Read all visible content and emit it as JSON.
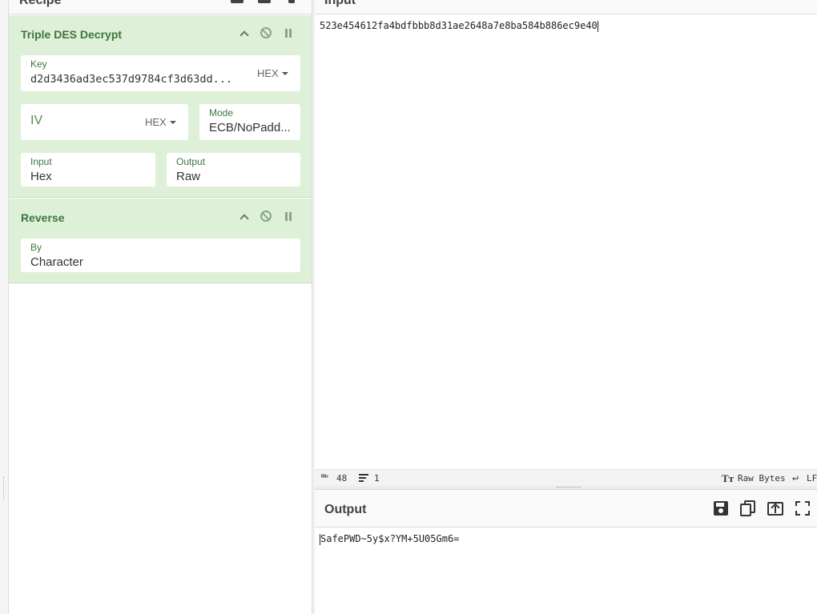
{
  "recipe": {
    "title": "Recipe",
    "operations": [
      {
        "name": "Triple DES Decrypt",
        "key": {
          "label": "Key",
          "value": "d2d3436ad3ec537d9784cf3d63dd...",
          "encoding": "HEX"
        },
        "iv": {
          "label": "IV",
          "encoding": "HEX"
        },
        "mode": {
          "label": "Mode",
          "value": "ECB/NoPadd..."
        },
        "input": {
          "label": "Input",
          "value": "Hex"
        },
        "output": {
          "label": "Output",
          "value": "Raw"
        }
      },
      {
        "name": "Reverse",
        "by": {
          "label": "By",
          "value": "Character"
        }
      }
    ]
  },
  "input": {
    "title": "Input",
    "text": "523e454612fa4bdfbbb8d31ae2648a7e8ba584b886ec9e40",
    "status": {
      "chars": "48",
      "lines": "1",
      "encoding": "Raw Bytes",
      "eol": "LF"
    }
  },
  "output": {
    "title": "Output",
    "text": "SafePWD~5y$x?YM+5U05Gm6="
  }
}
